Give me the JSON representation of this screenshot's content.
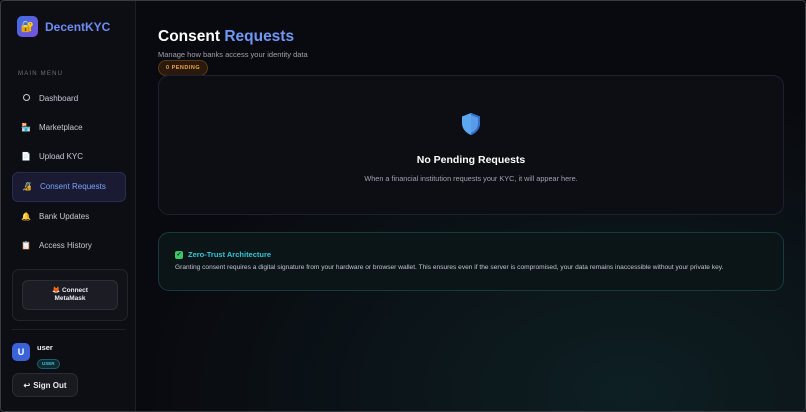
{
  "app": {
    "name": "DecentKYC",
    "logo_icon": "lock-icon"
  },
  "sidebar": {
    "heading": "MAIN MENU",
    "items": [
      {
        "label": "Dashboard",
        "icon": "circle-icon",
        "active": false
      },
      {
        "label": "Marketplace",
        "icon": "store-icon",
        "active": false
      },
      {
        "label": "Upload KYC",
        "icon": "document-icon",
        "active": false
      },
      {
        "label": "Consent Requests",
        "icon": "lock-icon",
        "active": true
      },
      {
        "label": "Bank Updates",
        "icon": "bell-icon",
        "active": false
      },
      {
        "label": "Access History",
        "icon": "clipboard-icon",
        "active": false
      }
    ],
    "connect": {
      "line1": "Connect",
      "line2": "MetaMask",
      "icon": "fox-icon"
    },
    "user": {
      "avatar": "U",
      "name": "user",
      "role": "USER"
    },
    "signout": {
      "label": "Sign Out",
      "icon": "return-arrow-icon"
    }
  },
  "main": {
    "title_part1": "Consent",
    "title_part2": "Requests",
    "subtitle": "Manage how banks access your identity data",
    "pending_badge": "0 PENDING",
    "empty": {
      "title": "No Pending Requests",
      "description": "When a financial institution requests your KYC, it will appear here."
    },
    "info": {
      "title": "Zero-Trust Architecture",
      "description": "Granting consent requires a digital signature from your hardware or browser wallet. This ensures even if the server is compromised, your data remains inaccessible without your private key."
    }
  },
  "colors": {
    "accent": "#6f98f6",
    "pending": "#f0a540",
    "info_title": "#2cc8d8",
    "check": "#3cc56a"
  }
}
